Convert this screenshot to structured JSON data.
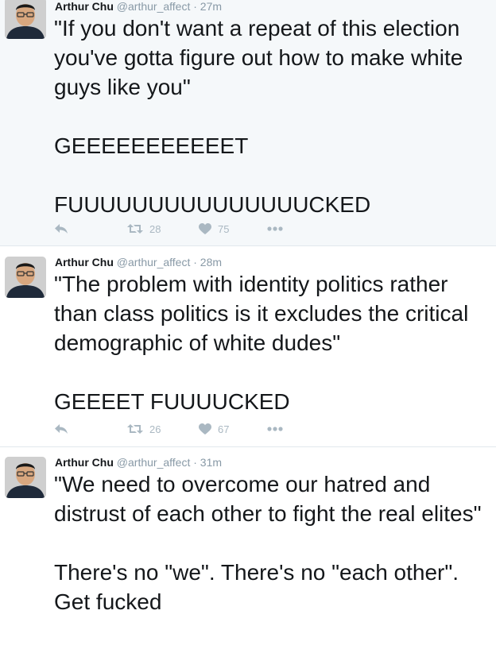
{
  "tweets": [
    {
      "name": "Arthur Chu",
      "handle": "@arthur_affect",
      "separator": "·",
      "time": "27m",
      "text": "\"If you don't want a repeat of this election you've gotta figure out how to make white guys like you\"\n\nGEEEEEEEEEEET\n\nFUUUUUUUUUUUUUUUCKED",
      "retweets": "28",
      "likes": "75"
    },
    {
      "name": "Arthur Chu",
      "handle": "@arthur_affect",
      "separator": "·",
      "time": "28m",
      "text": "\"The problem with identity politics rather than class politics is it excludes the critical demographic of white dudes\"\n\nGEEEET FUUUUCKED",
      "retweets": "26",
      "likes": "67"
    },
    {
      "name": "Arthur Chu",
      "handle": "@arthur_affect",
      "separator": "·",
      "time": "31m",
      "text": "\"We need to overcome our hatred and distrust of each other to fight the real elites\"\n\nThere's no \"we\". There's no \"each other\". Get fucked"
    }
  ],
  "icons": {
    "reply": "reply-icon",
    "retweet": "retweet-icon",
    "like": "heart-icon",
    "more": "more-icon",
    "action_color": "#aab8c2"
  }
}
